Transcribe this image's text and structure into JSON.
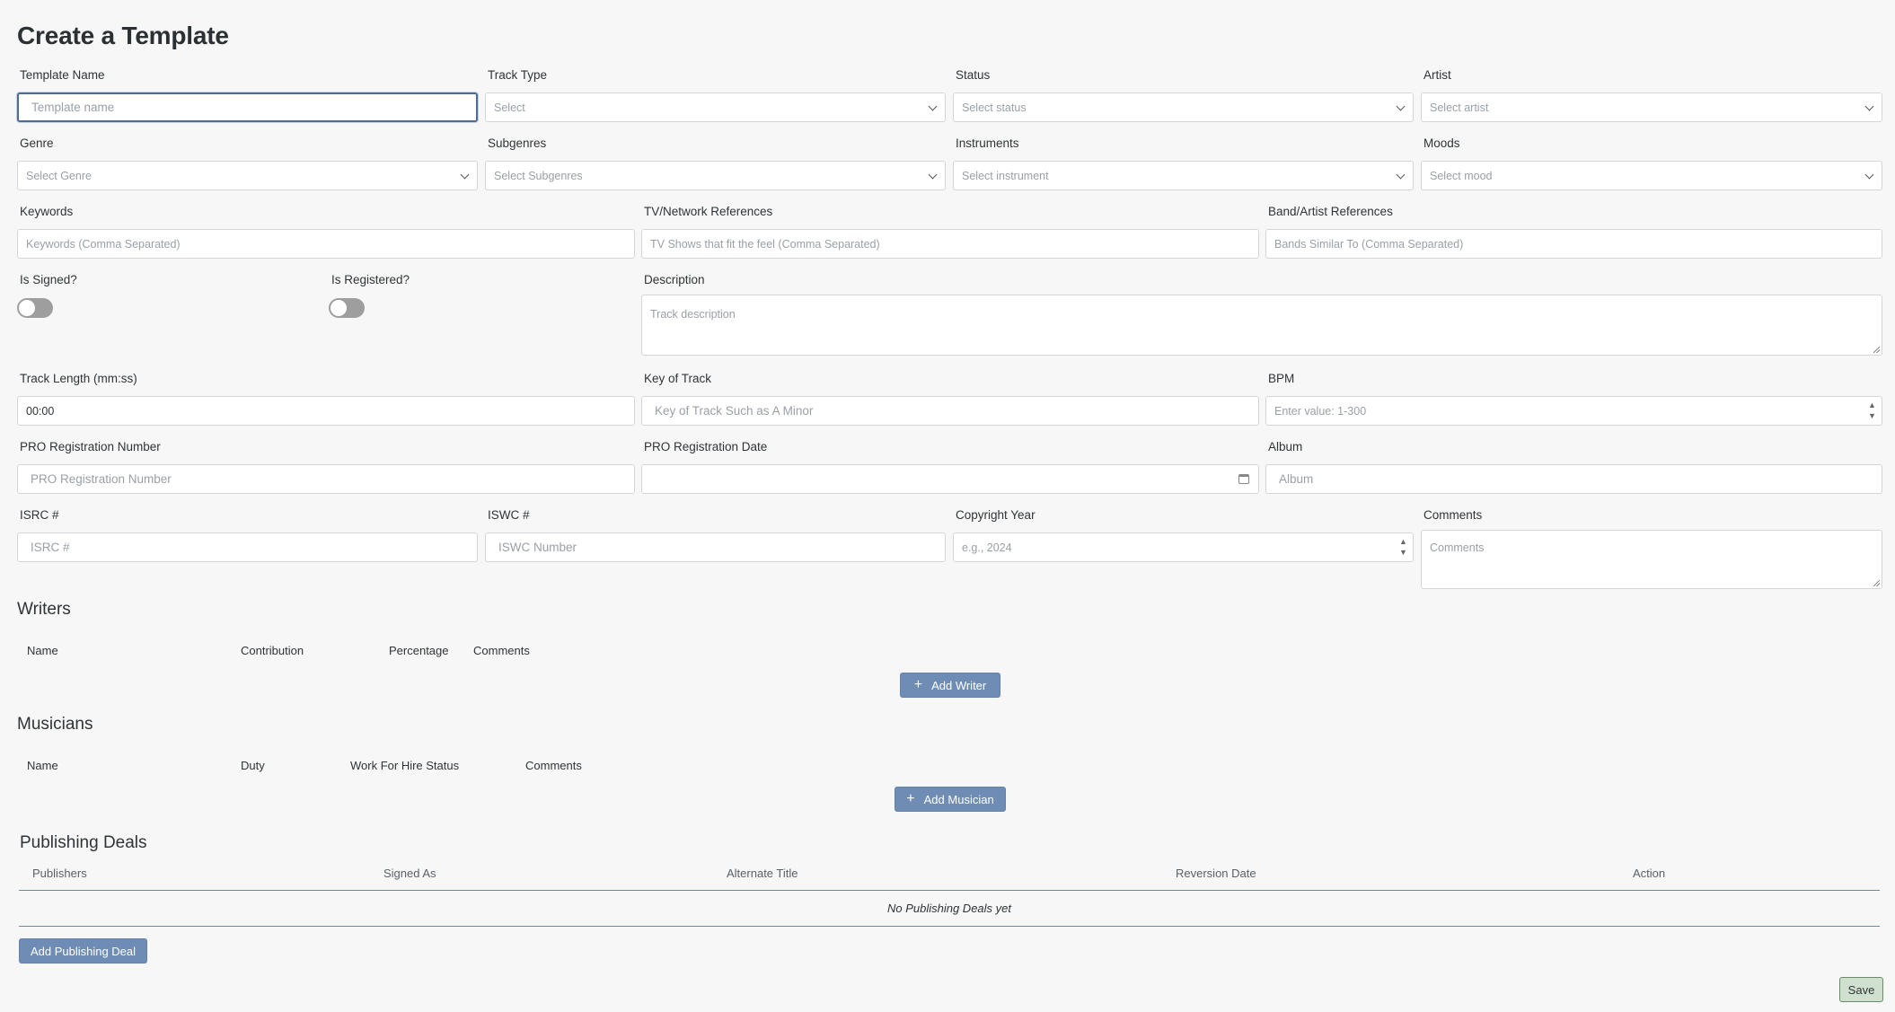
{
  "page_title": "Create a Template",
  "row1": {
    "template_name": {
      "label": "Template Name",
      "placeholder": "Template name"
    },
    "track_type": {
      "label": "Track Type",
      "placeholder": "Select"
    },
    "status": {
      "label": "Status",
      "placeholder": "Select status"
    },
    "artist": {
      "label": "Artist",
      "placeholder": "Select artist"
    }
  },
  "row2": {
    "genre": {
      "label": "Genre",
      "placeholder": "Select Genre"
    },
    "subgenres": {
      "label": "Subgenres",
      "placeholder": "Select Subgenres"
    },
    "instruments": {
      "label": "Instruments",
      "placeholder": "Select instrument"
    },
    "moods": {
      "label": "Moods",
      "placeholder": "Select mood"
    }
  },
  "row3": {
    "keywords": {
      "label": "Keywords",
      "placeholder": "Keywords (Comma Separated)"
    },
    "tv_refs": {
      "label": "TV/Network References",
      "placeholder": "TV Shows that fit the feel (Comma Separated)"
    },
    "band_refs": {
      "label": "Band/Artist References",
      "placeholder": "Bands Similar To (Comma Separated)"
    }
  },
  "row4": {
    "is_signed": {
      "label": "Is Signed?",
      "on": false
    },
    "is_registered": {
      "label": "Is Registered?",
      "on": false
    },
    "description": {
      "label": "Description",
      "placeholder": "Track description"
    }
  },
  "row5": {
    "track_length": {
      "label": "Track Length (mm:ss)",
      "value": "00:00"
    },
    "key": {
      "label": "Key of Track",
      "placeholder": "Key of Track Such as A Minor"
    },
    "bpm": {
      "label": "BPM",
      "placeholder": "Enter value: 1-300"
    }
  },
  "row6": {
    "pro_number": {
      "label": "PRO Registration Number",
      "placeholder": "PRO Registration Number"
    },
    "pro_date": {
      "label": "PRO Registration Date",
      "value": ""
    },
    "album": {
      "label": "Album",
      "placeholder": "Album"
    }
  },
  "row7": {
    "isrc": {
      "label": "ISRC #",
      "placeholder": "ISRC #"
    },
    "iswc": {
      "label": "ISWC #",
      "placeholder": "ISWC Number"
    },
    "copyright_year": {
      "label": "Copyright Year",
      "placeholder": "e.g., 2024"
    },
    "comments": {
      "label": "Comments",
      "placeholder": "Comments"
    }
  },
  "writers": {
    "title": "Writers",
    "columns": [
      "Name",
      "Contribution",
      "Percentage",
      "Comments"
    ],
    "add_label": "Add Writer"
  },
  "musicians": {
    "title": "Musicians",
    "columns": [
      "Name",
      "Duty",
      "Work For Hire Status",
      "Comments"
    ],
    "add_label": "Add Musician"
  },
  "publishing": {
    "title": "Publishing Deals",
    "columns": [
      "Publishers",
      "Signed As",
      "Alternate Title",
      "Reversion Date",
      "Action"
    ],
    "empty_text": "No Publishing Deals yet",
    "add_label": "Add Publishing Deal"
  },
  "save_label": "Save"
}
